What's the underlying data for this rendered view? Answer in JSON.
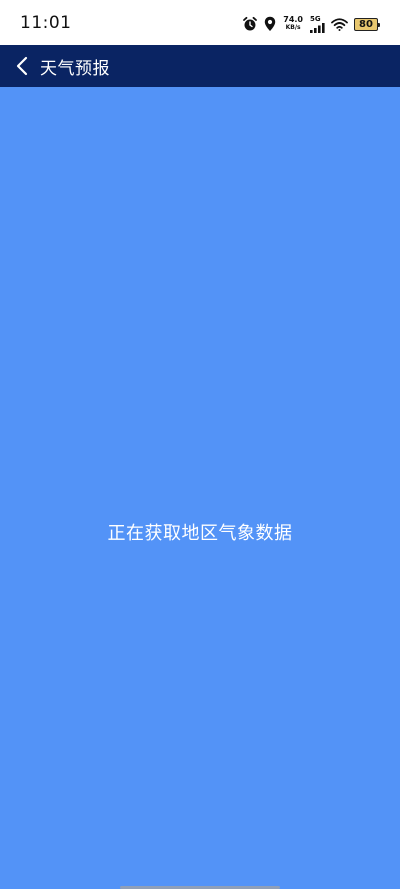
{
  "status_bar": {
    "time": "11:01",
    "net_speed_value": "74.0",
    "net_speed_unit": "KB/s",
    "signal_type": "5G",
    "battery_level": "80",
    "icons": [
      "alarm-icon",
      "location-icon",
      "signal-icon",
      "wifi-icon",
      "battery-icon"
    ]
  },
  "header": {
    "title": "天气预报",
    "back_icon": "chevron-left-icon"
  },
  "main": {
    "loading_message": "正在获取地区气象数据"
  },
  "colors": {
    "header_bg": "#0a2463",
    "content_bg": "#5393f7",
    "text_light": "#ffffff",
    "battery_fill": "#e8c76f"
  }
}
